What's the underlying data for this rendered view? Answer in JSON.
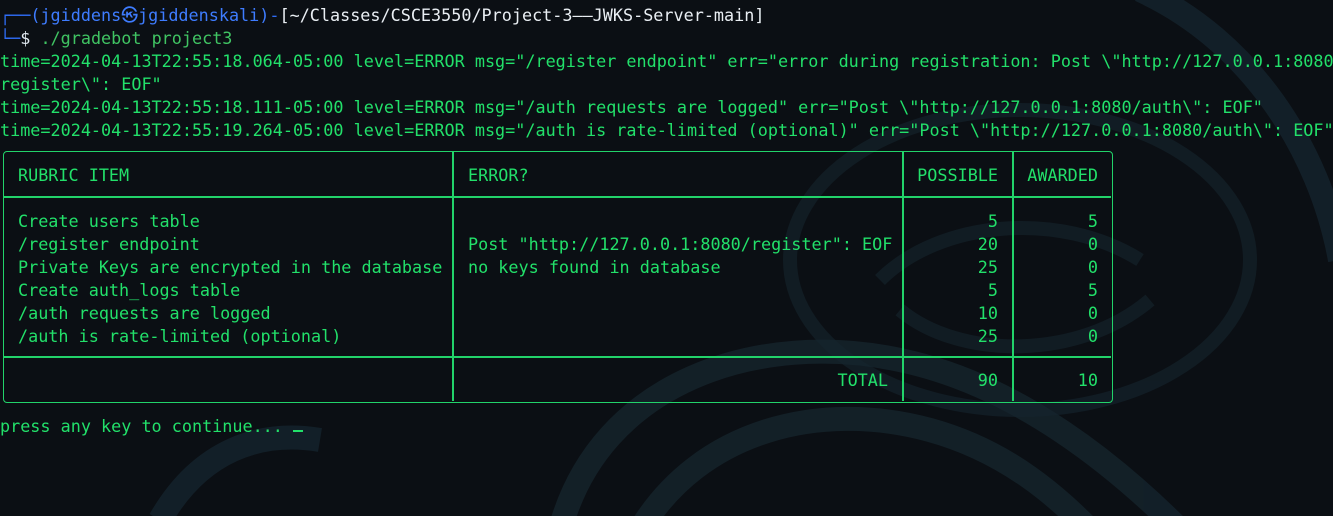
{
  "prompt": {
    "frame_top": "┌──",
    "user_host": "(jgiddens㉿jgiddenskali)",
    "dash": "-",
    "path": "[~/Classes/CSCE3550/Project-3——JWKS-Server-main]",
    "frame_bottom": "└─",
    "dollar": "$",
    "command": "./gradebot project3"
  },
  "logs": [
    "time=2024-04-13T22:55:18.064-05:00 level=ERROR msg=\"/register endpoint\" err=\"error during registration: Post \\\"http://127.0.0.1:8080/",
    "register\\\": EOF\"",
    "time=2024-04-13T22:55:18.111-05:00 level=ERROR msg=\"/auth requests are logged\" err=\"Post \\\"http://127.0.0.1:8080/auth\\\": EOF\"",
    "time=2024-04-13T22:55:19.264-05:00 level=ERROR msg=\"/auth is rate-limited (optional)\" err=\"Post \\\"http://127.0.0.1:8080/auth\\\": EOF\""
  ],
  "table": {
    "headers": [
      "RUBRIC ITEM",
      "ERROR?",
      "POSSIBLE",
      "AWARDED"
    ],
    "rows": [
      {
        "item": "Create users table",
        "error": "",
        "possible": "5",
        "awarded": "5"
      },
      {
        "item": "/register endpoint",
        "error": "Post \"http://127.0.0.1:8080/register\": EOF",
        "possible": "20",
        "awarded": "0"
      },
      {
        "item": "Private Keys are encrypted in the database",
        "error": "no keys found in database",
        "possible": "25",
        "awarded": "0"
      },
      {
        "item": "Create auth_logs table",
        "error": "",
        "possible": "5",
        "awarded": "5"
      },
      {
        "item": "/auth requests are logged",
        "error": "",
        "possible": "10",
        "awarded": "0"
      },
      {
        "item": "/auth is rate-limited (optional)",
        "error": "",
        "possible": "25",
        "awarded": "0"
      }
    ],
    "total_label": "TOTAL",
    "total_possible": "90",
    "total_awarded": "10"
  },
  "continue_text": "press any key to continue...",
  "colors": {
    "background": "#0b0f14",
    "text_green": "#22e06a",
    "prompt_blue": "#3e7cff"
  }
}
